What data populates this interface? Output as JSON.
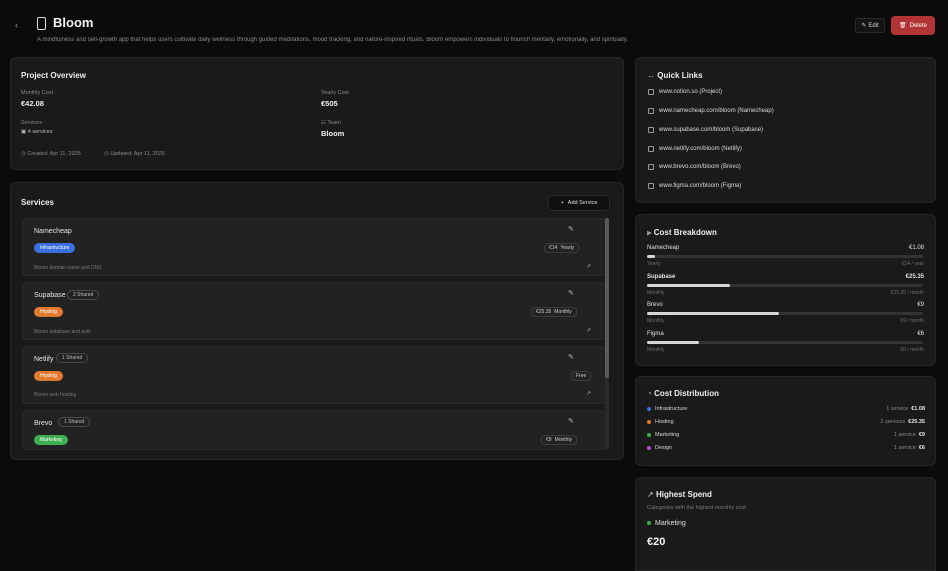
{
  "header": {
    "back_glyph": "‹",
    "title": "Bloom",
    "description": "A mindfulness and self-growth app that helps users cultivate daily wellness through guided meditations, mood tracking, and nature-inspired rituals. Bloom empowers individuals to flourish mentally, emotionally, and spiritually.",
    "edit_label": "Edit",
    "delete_label": "Delete"
  },
  "overview": {
    "title": "Project Overview",
    "monthly_cost_label": "Monthly Cost",
    "monthly_cost_value": "€42.08",
    "yearly_cost_label": "Yearly Cost",
    "yearly_cost_value": "€505",
    "services_label": "Services",
    "services_value": "4 services",
    "team_label": "Team",
    "team_value": "Bloom",
    "created": "Created: Apr 11, 2025",
    "updated": "Updated: Apr 11, 2025"
  },
  "services": {
    "title": "Services",
    "add_label": "Add Service",
    "items": [
      {
        "name": "Namecheap",
        "chip": "",
        "badge": "Infrastructure",
        "badge_color": "#3b6fe0",
        "price_amount": "€14",
        "price_period": "Yearly",
        "desc": "Bloom domain name and DNS"
      },
      {
        "name": "Supabase",
        "chip": "2 Shared",
        "badge": "Hosting",
        "badge_color": "#e07a2f",
        "price_amount": "€25.35",
        "price_period": "Monthly",
        "desc": "Bloom database and auth"
      },
      {
        "name": "Netlify",
        "chip": "1 Shared",
        "badge": "Hosting",
        "badge_color": "#e07a2f",
        "price_amount": "",
        "price_period": "Free",
        "desc": "Bloom web hosting"
      },
      {
        "name": "Brevo",
        "chip": "1 Shared",
        "badge": "Marketing",
        "badge_color": "#3fae4f",
        "price_amount": "€9",
        "price_period": "Monthly",
        "desc": ""
      }
    ]
  },
  "quick_links": {
    "title": "Quick Links",
    "items": [
      "www.notion.so (Project)",
      "www.namecheap.com/bloom (Namecheap)",
      "www.supabase.com/bloom (Supabase)",
      "www.netlify.com/bloom (Netlify)",
      "www.brevo.com/bloom (Brevo)",
      "www.figma.com/bloom (Figma)"
    ]
  },
  "cost_breakdown": {
    "title": "Cost Breakdown",
    "items": [
      {
        "name": "Namecheap",
        "value": "€1.08",
        "percent": 3,
        "left": "Yearly",
        "right": "€14 / year"
      },
      {
        "name": "Supabase",
        "value": "€25.35",
        "percent": 30,
        "left": "Monthly",
        "right": "€25.35 / month"
      },
      {
        "name": "Brevo",
        "value": "€9",
        "percent": 48,
        "left": "Monthly",
        "right": "€9 / month"
      },
      {
        "name": "Figma",
        "value": "€6",
        "percent": 19,
        "left": "Monthly",
        "right": "€6 / month"
      }
    ]
  },
  "cost_distribution": {
    "title": "Cost Distribution",
    "items": [
      {
        "name": "Infrastructure",
        "color": "#3b6fe0",
        "right_label": "1 service",
        "value": "€1.08"
      },
      {
        "name": "Hosting",
        "color": "#e07a2f",
        "right_label": "2 services",
        "value": "€25.35"
      },
      {
        "name": "Marketing",
        "color": "#3fae4f",
        "right_label": "1 service",
        "value": "€9"
      },
      {
        "name": "Design",
        "color": "#b34fc9",
        "right_label": "1 service",
        "value": "€6"
      }
    ]
  },
  "highest_spend": {
    "title": "Highest Spend",
    "subtitle": "Categories with the highest monthly cost",
    "category": "Marketing",
    "category_color": "#3fae4f",
    "value": "€20"
  }
}
